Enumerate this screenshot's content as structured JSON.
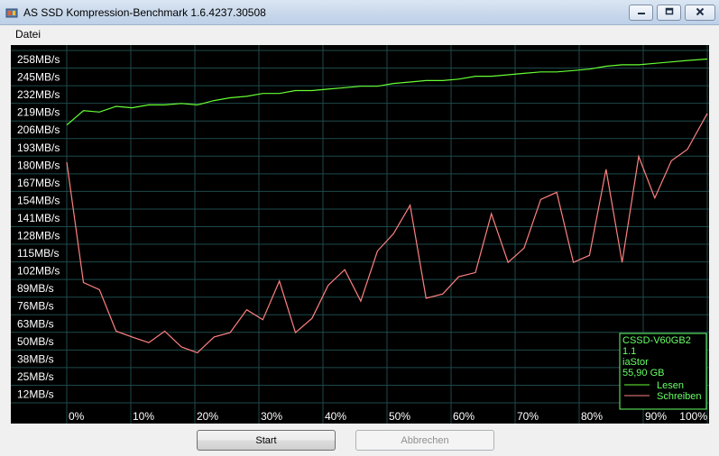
{
  "window": {
    "title": "AS SSD Kompression-Benchmark 1.6.4237.30508",
    "icon": "as-ssd-app-icon",
    "controls": [
      "minimize-icon",
      "maximize-icon",
      "close-icon"
    ]
  },
  "menu": {
    "items": [
      {
        "label": "Datei"
      }
    ]
  },
  "buttons": {
    "start": {
      "label": "Start",
      "enabled": true
    },
    "abort": {
      "label": "Abbrechen",
      "enabled": false
    }
  },
  "chart_data": {
    "type": "line",
    "y_tick_labels": [
      "258MB/s",
      "245MB/s",
      "232MB/s",
      "219MB/s",
      "206MB/s",
      "193MB/s",
      "180MB/s",
      "167MB/s",
      "154MB/s",
      "141MB/s",
      "128MB/s",
      "115MB/s",
      "102MB/s",
      "89MB/s",
      "76MB/s",
      "63MB/s",
      "50MB/s",
      "38MB/s",
      "25MB/s",
      "12MB/s"
    ],
    "x_tick_labels": [
      "0%",
      "10%",
      "20%",
      "30%",
      "40%",
      "50%",
      "60%",
      "70%",
      "80%",
      "90%",
      "100%"
    ],
    "ylim": [
      12,
      258
    ],
    "xlim": [
      0,
      100
    ],
    "grid": true,
    "legend_placement": "bottom-right",
    "info": {
      "device": "CSSD-V60GB2",
      "firmware": "1.1",
      "driver": "iaStor",
      "capacity": "55,90 GB"
    },
    "colors": {
      "background": "#000000",
      "grid": "#1e4a4a",
      "text": "#ffffff",
      "lesen": "#66ff33",
      "schreiben": "#ff8080",
      "legend_text": "#66ff66"
    },
    "series": [
      {
        "name": "Lesen",
        "x": [
          0,
          2.6,
          5.1,
          7.7,
          10.2,
          12.8,
          15.3,
          17.9,
          20.4,
          23,
          25.5,
          28.1,
          30.6,
          33.2,
          35.7,
          38.3,
          40.8,
          43.4,
          45.9,
          48.5,
          51,
          53.6,
          56.1,
          58.7,
          61.2,
          63.8,
          66.3,
          68.9,
          71.4,
          74,
          76.5,
          79.1,
          81.6,
          84.2,
          86.7,
          89.3,
          91.8,
          94.4,
          96.9,
          100
        ],
        "values": [
          206,
          216,
          215,
          219,
          218,
          220,
          220,
          221,
          220,
          223,
          225,
          226,
          228,
          228,
          230,
          230,
          231,
          232,
          233,
          233,
          235,
          236,
          237,
          237,
          238,
          240,
          240,
          241,
          242,
          243,
          243,
          244,
          245,
          247,
          248,
          248,
          249,
          250,
          251,
          252
        ]
      },
      {
        "name": "Schreiben",
        "x": [
          0,
          2.6,
          5.1,
          7.7,
          10.2,
          12.8,
          15.3,
          17.9,
          20.4,
          23,
          25.5,
          28.1,
          30.6,
          33.2,
          35.7,
          38.3,
          40.8,
          43.4,
          45.9,
          48.5,
          51,
          53.6,
          56.1,
          58.7,
          61.2,
          63.8,
          66.3,
          68.9,
          71.4,
          74,
          76.5,
          79.1,
          81.6,
          84.2,
          86.7,
          89.3,
          91.8,
          94.4,
          96.9,
          100
        ],
        "values": [
          180,
          96,
          91,
          62,
          58,
          54,
          62,
          51,
          47,
          58,
          61,
          77,
          70,
          97,
          61,
          71,
          94,
          105,
          83,
          118,
          130,
          150,
          85,
          88,
          100,
          103,
          144,
          110,
          120,
          154,
          159,
          110,
          115,
          175,
          110,
          184,
          155,
          181,
          189,
          214
        ]
      }
    ]
  }
}
